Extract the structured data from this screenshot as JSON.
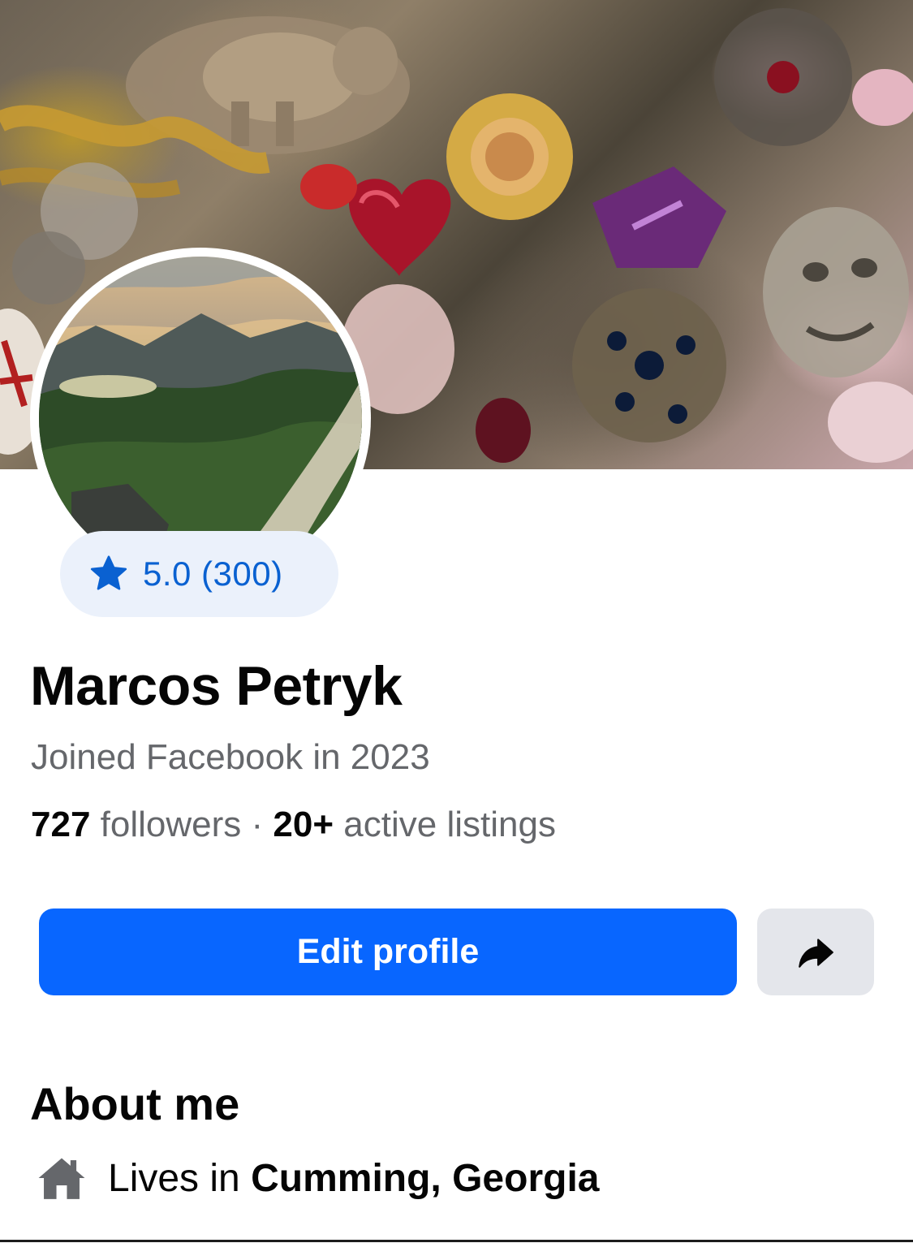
{
  "profile": {
    "name": "Marcos Petryk",
    "joined": "Joined Facebook in 2023",
    "rating": "5.0 (300)",
    "followers_count": "727",
    "followers_label": "followers",
    "separator": "·",
    "listings_count": "20+",
    "listings_label": "active listings"
  },
  "actions": {
    "edit_profile_label": "Edit profile",
    "share_icon": "share-arrow-icon"
  },
  "about": {
    "title": "About me",
    "lives_prefix": "Lives in",
    "city": "Cumming, Georgia",
    "icon": "home-icon"
  },
  "colors": {
    "primary_button": "#0866ff",
    "rating_text": "#0a61d1",
    "rating_bg": "#ebf1fb",
    "secondary_button": "#e4e6eb",
    "secondary_text": "#65676b"
  }
}
